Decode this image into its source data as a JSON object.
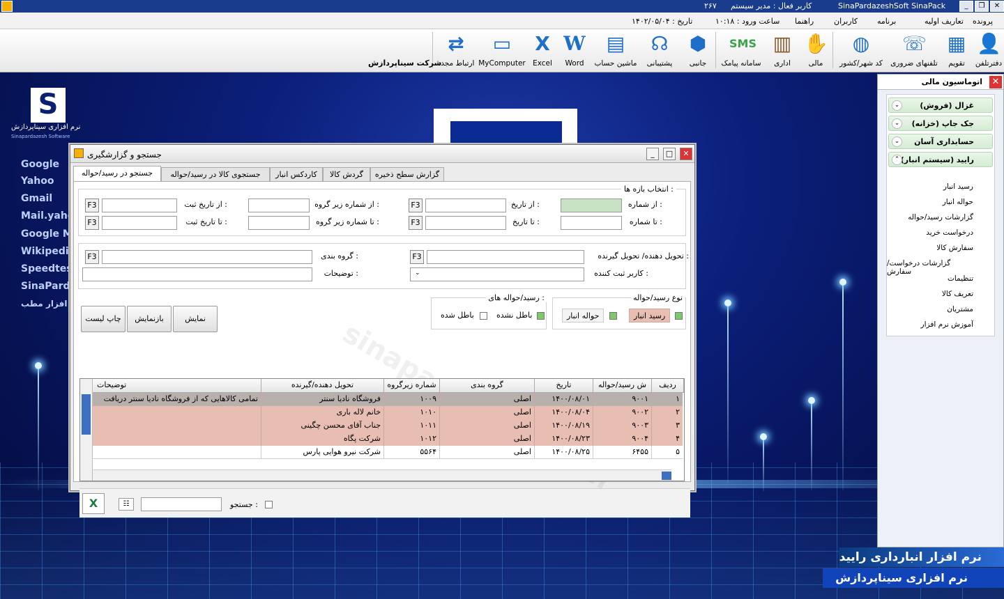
{
  "titlebar": {
    "app": "SinaPardazeshSoft SinaPack",
    "user": "کاربر فعال : مدیر سیستم",
    "number": "۲۶۷"
  },
  "menu": [
    "پرونده",
    "تعاریف اولیه",
    "برنامه",
    "کاربران",
    "راهنما"
  ],
  "status": {
    "login_time": "ساعت ورود : ۱۰:۱۸",
    "date": "تاریخ : ۱۴۰۲/۰۵/۰۴"
  },
  "company": "شرکت سیناپردازش",
  "toolbar": [
    {
      "label": "دفترتلفن",
      "icon": "phonebook-icon"
    },
    {
      "label": "تقویم",
      "icon": "calendar-icon"
    },
    {
      "label": "تلفنهای ضروری",
      "icon": "phone-icon"
    },
    {
      "label": "کد شهر/کشور",
      "icon": "globe-icon"
    },
    {
      "label": "مالی",
      "icon": "finance-icon"
    },
    {
      "label": "اداری",
      "icon": "office-icon"
    },
    {
      "label": "سامانه پیامک",
      "icon": "sms-icon"
    },
    {
      "label": "جانبی",
      "icon": "box-icon"
    },
    {
      "label": "پشتیبانی",
      "icon": "support-icon"
    },
    {
      "label": "ماشین حساب",
      "icon": "calculator-icon"
    },
    {
      "label": "Word",
      "icon": "word-icon"
    },
    {
      "label": "Excel",
      "icon": "excel-icon"
    },
    {
      "label": "MyComputer",
      "icon": "computer-icon"
    },
    {
      "label": "ارتباط مجدد",
      "icon": "reconnect-icon"
    }
  ],
  "side_panel": {
    "title": "اتوماسیون مالی",
    "sections": [
      "غزال (فروش)",
      "جک جاپ (خزانه)",
      "حسابداری آسان",
      "رایید (سیستم انبار)"
    ],
    "items": [
      "رسید انبار",
      "حواله انبار",
      "گزارشات رسید/حواله",
      "درخواست خرید",
      "سفارش کالا",
      "گزارشات درخواست/سفارش",
      "تنظیمات",
      "تعریف کالا",
      "مشتریان",
      "آموزش نرم افزار"
    ],
    "brand1": "نرم افزار انبارداری رایید",
    "brand2": "نرم افزاری سیناپردازش"
  },
  "desktop": {
    "logo_text": "نرم افزاری سیناپردازش",
    "logo_sub": "Sinapardazesh Software",
    "links": [
      "Google",
      "Yahoo",
      "Gmail",
      "Mail.yahoo",
      "Google M",
      "Wikipedia",
      "Speedtes",
      "SinaParda",
      "نرم افزار مطب"
    ]
  },
  "dialog": {
    "title": "جستجو و گزارشگیری",
    "tabs": [
      "جستجو در رسید/حواله",
      "جستجوی کالا در رسید/حواله",
      "کاردکس انبار",
      "گردش کالا",
      "گزارش سطح ذخیره"
    ],
    "range_group": "انتخاب بازه ها :",
    "from_number": "از شماره :",
    "to_number": "تا شماره :",
    "from_date": "از تاریخ :",
    "to_date": "تا تاریخ :",
    "from_subgroup": "از شماره زیر گروه :",
    "to_subgroup": "تا شماره زیر گروه :",
    "from_reg_date": "از تاریخ ثبت :",
    "to_reg_date": "تا تاریخ ثبت :",
    "deliverer": "تحویل دهنده/ تحویل گیرنده :",
    "group": "گروه بندی :",
    "registrar": "کاربر ثبت کننده :",
    "notes": "توضیحات :",
    "f3": "F3",
    "type_group": "نوع رسید/حواله",
    "type_receipt": "رسید انبار",
    "type_transfer": "حواله انبار",
    "status_group": "رسید/حواله های :",
    "not_void": "باطل نشده",
    "void": "باطل شده",
    "btn_show": "نمایش",
    "btn_reshow": "بازنمایش",
    "btn_print": "چاپ لیست",
    "search_label": "جستجو :",
    "watermark": "sinapardazesh.com"
  },
  "table": {
    "headers": [
      "ردیف",
      "ش رسید/حواله",
      "تاریخ",
      "گروه بندی",
      "شماره زیرگروه",
      "تحویل دهنده/گیرنده",
      "توضیحات"
    ],
    "rows": [
      [
        "۱",
        "۹۰۰۱",
        "۱۴۰۰/۰۸/۰۱",
        "اصلی",
        "۱۰۰۹",
        "فروشگاه نادیا سنتر",
        "تمامی کالاهایی که از فروشگاه نادیا سنتر دریافت"
      ],
      [
        "۲",
        "۹۰۰۲",
        "۱۴۰۰/۰۸/۰۴",
        "اصلی",
        "۱۰۱۰",
        "خانم لاله باری",
        ""
      ],
      [
        "۳",
        "۹۰۰۳",
        "۱۴۰۰/۰۸/۱۹",
        "اصلی",
        "۱۰۱۱",
        "جناب آقای محسن چگینی",
        ""
      ],
      [
        "۴",
        "۹۰۰۴",
        "۱۴۰۰/۰۸/۲۳",
        "اصلی",
        "۱۰۱۲",
        "شرکت پگاه",
        ""
      ],
      [
        "۵",
        "۶۴۵۵",
        "۱۴۰۰/۰۸/۲۵",
        "اصلی",
        "۵۵۶۴",
        "شرکت نیرو هوایی پارس",
        ""
      ]
    ]
  },
  "colors": {
    "selected_row": "#b7b0ac",
    "highlight_row": "#e9beb2",
    "title_bar": "#1a3c8c"
  }
}
